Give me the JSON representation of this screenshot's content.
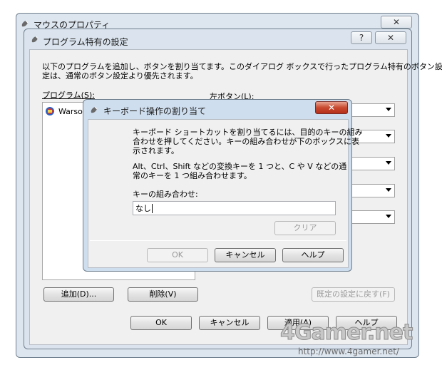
{
  "mouse_props": {
    "title": "マウスのプロパティ"
  },
  "app_settings": {
    "title": "プログラム特有の設定",
    "help_icon": "?",
    "close_icon": "✕",
    "description_line1": "以下のプログラムを追加し、ボタンを割り当てます。このダイアログ ボックスで行ったプログラム特有のボタン設",
    "description_line2": "定は、通常のボタン設定より優先されます。",
    "programs_label": "プログラム(S):",
    "program_item": "Warso",
    "left_button_label": "左ボタン(L):",
    "add_button": "追加(D)...",
    "delete_button": "削除(V)",
    "restore_defaults_button": "既定の設定に戻す(F)",
    "ok_button": "OK",
    "cancel_button": "キャンセル",
    "apply_button": "適用(A)",
    "help_button": "ヘルプ"
  },
  "keyboard_dialog": {
    "title": "キーボード操作の割り当て",
    "close_icon": "✕",
    "instruction_line1": "キーボード ショートカットを割り当てるには、目的のキーの組み",
    "instruction_line2": "合わせを押してください。キーの組み合わせが下のボックスに表",
    "instruction_line3": "示されます。",
    "hint_line1": "Alt、Ctrl、Shift などの変換キーを 1 つと、C や V などの通",
    "hint_line2": "常のキーを 1 つ組み合わせます。",
    "combo_label": "キーの組み合わせ:",
    "combo_value": "なし",
    "clear_button": "クリア",
    "ok_button": "OK",
    "cancel_button": "キャンセル",
    "help_button": "ヘルプ"
  },
  "watermark": {
    "logo": "4Gamer.net",
    "url": "http://www.4gamer.net/"
  }
}
